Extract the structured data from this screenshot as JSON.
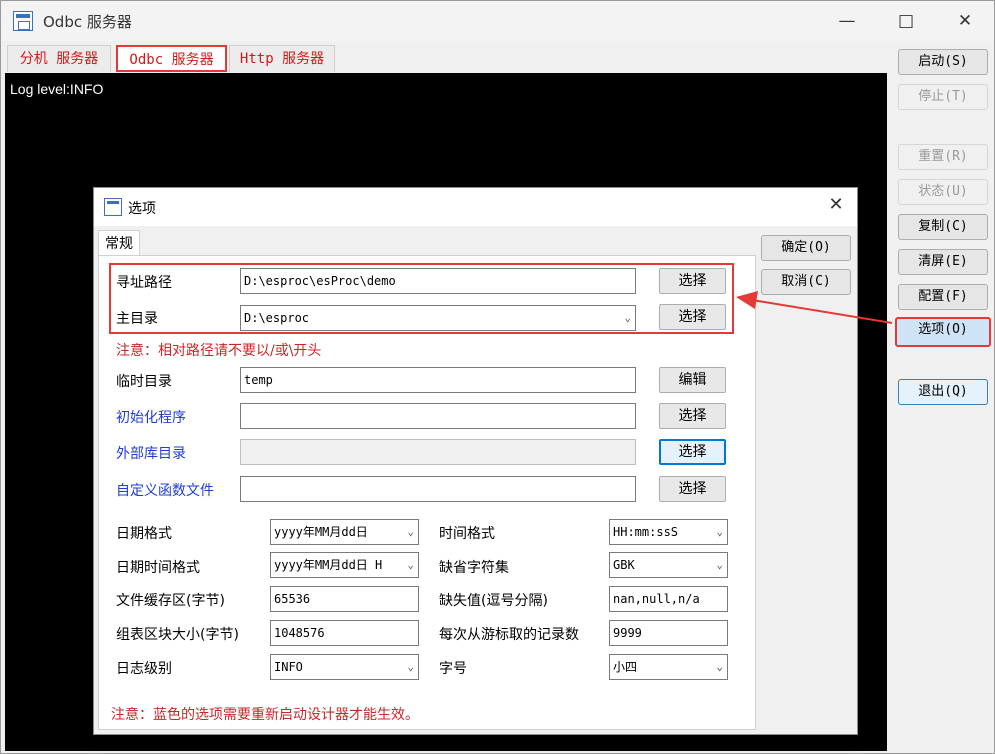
{
  "window": {
    "title": "Odbc 服务器"
  },
  "tabs": [
    {
      "label": "分机 服务器"
    },
    {
      "label": "Odbc 服务器"
    },
    {
      "label": "Http 服务器"
    }
  ],
  "console": {
    "text": "Log level:INFO"
  },
  "right_buttons": {
    "start": "启动(S)",
    "stop": "停止(T)",
    "reset": "重置(R)",
    "status": "状态(U)",
    "copy": "复制(C)",
    "clear": "清屏(E)",
    "config": "配置(F)",
    "options": "选项(O)",
    "exit": "退出(Q)"
  },
  "dialog": {
    "title": "选项",
    "tab": "常规",
    "ok": "确定(O)",
    "cancel": "取消(C)",
    "search_path_label": "寻址路径",
    "search_path_value": "D:\\esproc\\esProc\\demo",
    "main_dir_label": "主目录",
    "main_dir_value": "D:\\esproc",
    "choose": "选择",
    "edit": "编辑",
    "note_path": "注意：相对路径请不要以/或\\开头",
    "temp_dir_label": "临时目录",
    "temp_dir_value": "temp",
    "init_program_label": "初始化程序",
    "init_program_value": "",
    "ext_lib_label": "外部库目录",
    "ext_lib_value": "",
    "custom_func_label": "自定义函数文件",
    "custom_func_value": "",
    "date_format_label": "日期格式",
    "date_format_value": "yyyy年MM月dd日",
    "time_format_label": "时间格式",
    "time_format_value": "HH:mm:ssS",
    "datetime_format_label": "日期时间格式",
    "datetime_format_value": "yyyy年MM月dd日 H",
    "charset_label": "缺省字符集",
    "charset_value": "GBK",
    "file_buffer_label": "文件缓存区(字节)",
    "file_buffer_value": "65536",
    "missing_label": "缺失值(逗号分隔)",
    "missing_value": "nan,null,n/a",
    "block_size_label": "组表区块大小(字节)",
    "block_size_value": "1048576",
    "fetch_count_label": "每次从游标取的记录数",
    "fetch_count_value": "9999",
    "log_level_label": "日志级别",
    "log_level_value": "INFO",
    "font_size_label": "字号",
    "font_size_value": "小四",
    "note_blue": "注意：蓝色的选项需要重新启动设计器才能生效。"
  },
  "colors": {
    "highlight": "#e53935",
    "blue_label": "#1f3dd6",
    "note": "#c62828"
  }
}
